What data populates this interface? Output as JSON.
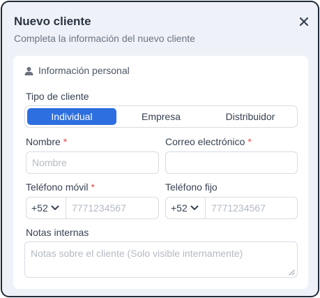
{
  "dialog": {
    "title": "Nuevo cliente",
    "subtitle": "Completa la información del nuevo cliente",
    "close_icon": "close-icon"
  },
  "section": {
    "icon": "user-icon",
    "title": "Información personal"
  },
  "client_type": {
    "label": "Tipo de cliente",
    "options": [
      "Individual",
      "Empresa",
      "Distribuidor"
    ],
    "selected": "Individual"
  },
  "fields": {
    "nombre": {
      "label": "Nombre",
      "required_mark": "*",
      "placeholder": "Nombre",
      "value": ""
    },
    "correo": {
      "label": "Correo electrónico",
      "required_mark": "*",
      "placeholder": "",
      "value": ""
    },
    "telefono_movil": {
      "label": "Teléfono móvil",
      "required_mark": "*",
      "country_code": "+52",
      "placeholder": "7771234567",
      "value": ""
    },
    "telefono_fijo": {
      "label": "Teléfono fijo",
      "country_code": "+52",
      "placeholder": "7771234567",
      "value": ""
    },
    "notas": {
      "label": "Notas internas",
      "placeholder": "Notas sobre el cliente (Solo visible internamente)",
      "value": ""
    }
  },
  "colors": {
    "accent": "#2d6fe0",
    "required": "#ef4444",
    "dialog_bg": "#eef2f8",
    "card_bg": "#ffffff"
  }
}
